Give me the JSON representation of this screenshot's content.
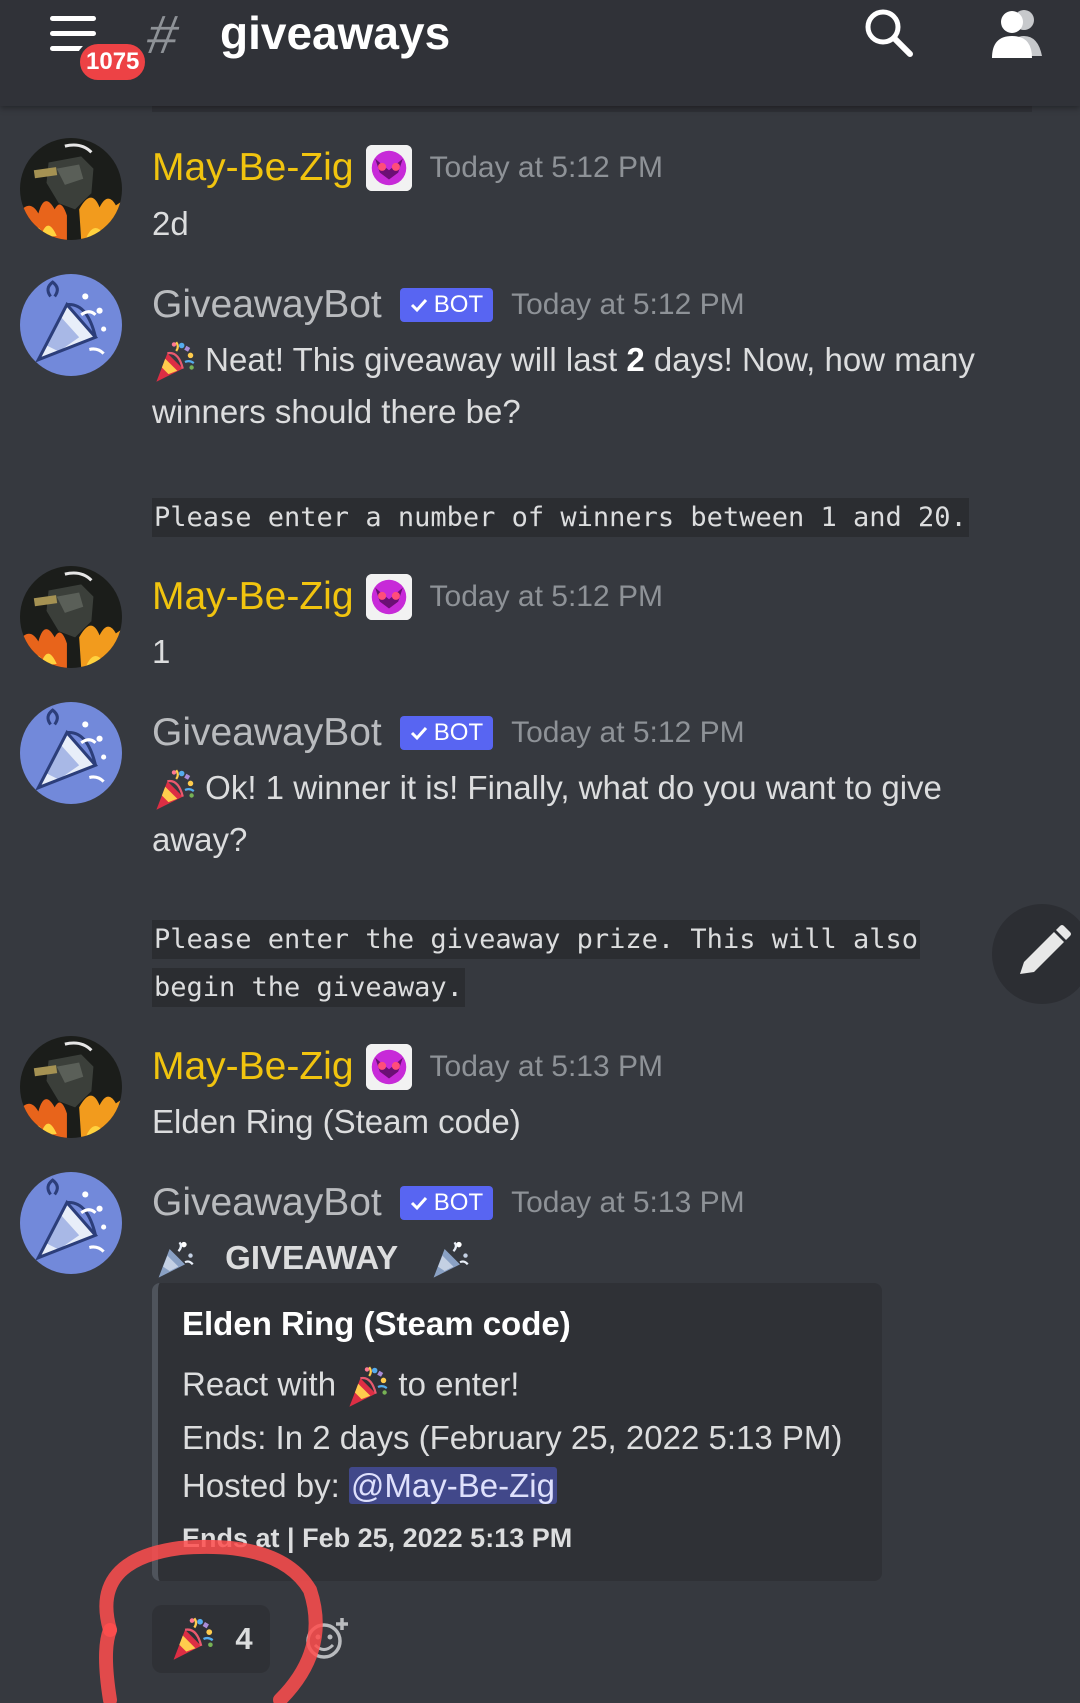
{
  "header": {
    "badge_count": "1075",
    "channel_hash": "#",
    "channel_name": "giveaways"
  },
  "messages": [
    {
      "author": "May-Be-Zig",
      "timestamp": "Today at 5:12 PM",
      "text": "2d"
    },
    {
      "author": "GiveawayBot",
      "bot_tag": "BOT",
      "timestamp": "Today at 5:12 PM",
      "text_pre": " Neat! This giveaway will last ",
      "text_bold": "2",
      "text_post": " days! Now, how many winners should there be?",
      "code": "Please enter a number of winners between 1 and 20."
    },
    {
      "author": "May-Be-Zig",
      "timestamp": "Today at 5:12 PM",
      "text": "1"
    },
    {
      "author": "GiveawayBot",
      "bot_tag": "BOT",
      "timestamp": "Today at 5:12 PM",
      "text": " Ok! 1 winner it is! Finally, what do you want to give away?",
      "code_line1": "Please enter the giveaway prize. This will also",
      "code_line2": "begin the giveaway."
    },
    {
      "author": "May-Be-Zig",
      "timestamp": "Today at 5:13 PM",
      "text": "Elden Ring (Steam code)"
    },
    {
      "author": "GiveawayBot",
      "bot_tag": "BOT",
      "timestamp": "Today at 5:13 PM",
      "text": "GIVEAWAY"
    }
  ],
  "embed": {
    "title": "Elden Ring (Steam code)",
    "react_pre": "React with ",
    "react_post": " to enter!",
    "ends": "Ends: In 2 days (February 25, 2022 5:13 PM)",
    "hosted_label": "Hosted by: ",
    "hosted_mention": "@May-Be-Zig",
    "footer": "Ends at | Feb 25, 2022 5:13 PM"
  },
  "reaction": {
    "emoji": "tada-icon",
    "count": "4"
  },
  "colors": {
    "background": "#36393f",
    "header": "#303238",
    "username_user": "#f1c40f",
    "username_bot": "#b9bbbe",
    "bot_tag": "#5865f2",
    "badge": "#ed4245",
    "mention": "#5865f2",
    "annotation": "#ff4d4d"
  }
}
